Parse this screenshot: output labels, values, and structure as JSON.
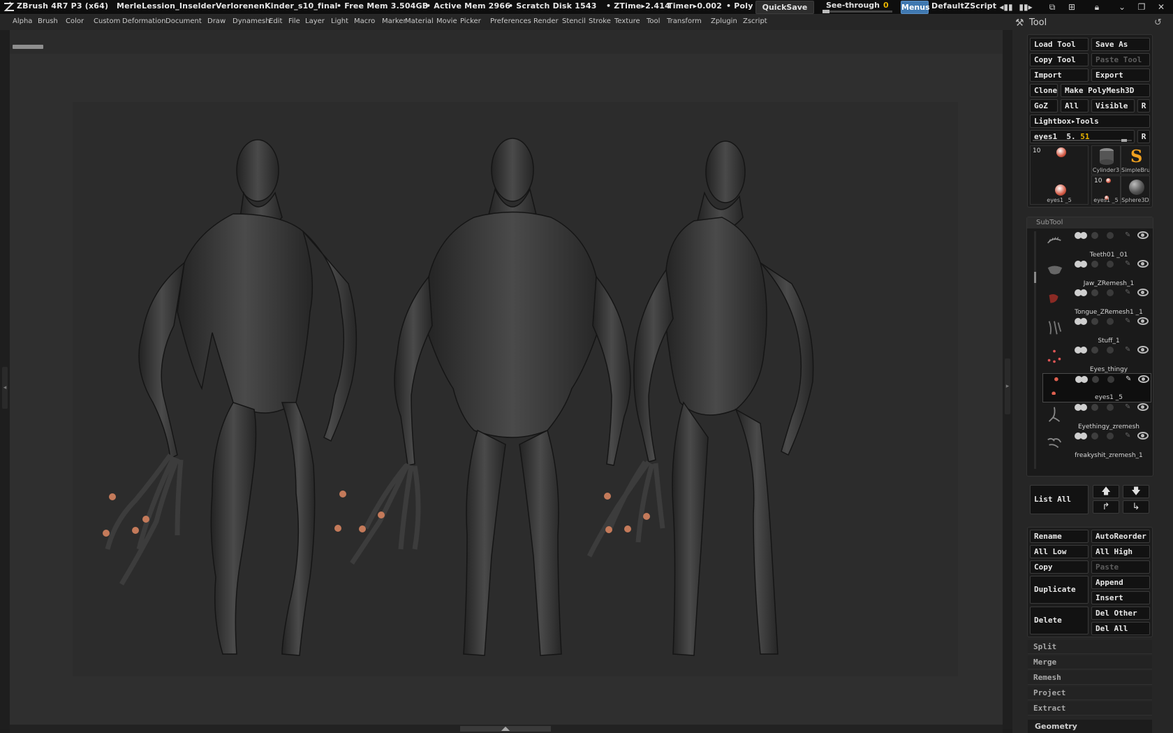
{
  "titlebar": {
    "app": "ZBrush 4R7 P3 (x64)",
    "document": "MerleLession_InselderVerlorenenKinder_s10_final",
    "free_mem": "• Free Mem 3.504GB",
    "active_mem": "• Active Mem 2966",
    "scratch_disk": "• Scratch Disk 1543",
    "ztime": "• ZTime▸2.414",
    "timer": "Timer▸0.002",
    "poly": "• Poly(",
    "quicksave": "QuickSave",
    "see_through_label": "See-through",
    "see_through_value": "0",
    "menus": "Menus",
    "default_zscript": "DefaultZScript"
  },
  "menubar": {
    "items": [
      "Alpha",
      "Brush",
      "Color",
      "Custom",
      "Deformation",
      "Document",
      "Draw",
      "Dynamesh",
      "Edit",
      "File",
      "Layer",
      "Light",
      "Macro",
      "Marker",
      "Material",
      "Movie",
      "Picker",
      "Preferences",
      "Render",
      "Stencil",
      "Stroke",
      "Texture",
      "Tool",
      "Transform",
      "Zplugin",
      "Zscript"
    ]
  },
  "tool_palette": {
    "title": "Tool",
    "buttons": {
      "load_tool": "Load Tool",
      "save_as": "Save As",
      "copy_tool": "Copy Tool",
      "paste_tool": "Paste Tool",
      "import": "Import",
      "export": "Export",
      "clone": "Clone",
      "make_polymesh3d": "Make PolyMesh3D",
      "goz": "GoZ",
      "all": "All",
      "visible": "Visible",
      "r": "R",
      "lightbox_tools": "Lightbox▸Tools"
    },
    "current_tool": {
      "name": "eyes1 _5.",
      "value": "51",
      "r": "R"
    },
    "thumbnails": [
      {
        "count": "10",
        "caption": "eyes1 _5"
      },
      {
        "count": "",
        "caption": "Cylinder3"
      },
      {
        "count": "",
        "caption": "SimpleBru"
      },
      {
        "count": "10",
        "caption": "eyes1 _5"
      },
      {
        "count": "",
        "caption": "Sphere3D"
      }
    ]
  },
  "subtool": {
    "title": "SubTool",
    "items": [
      {
        "name": "Teeth01 _01",
        "selected": false
      },
      {
        "name": "Jaw_ZRemesh_1",
        "selected": false
      },
      {
        "name": "Tongue_ZRemesh1 _1",
        "selected": false
      },
      {
        "name": "Stuff_1",
        "selected": false
      },
      {
        "name": "Eyes_thingy",
        "selected": false
      },
      {
        "name": "eyes1 _5",
        "selected": true
      },
      {
        "name": "Eyethingy_zremesh",
        "selected": false
      },
      {
        "name": "freakyshit_zremesh_1",
        "selected": false
      }
    ],
    "list_all": "List All",
    "rename": "Rename",
    "autoreorder": "AutoReorder",
    "all_low": "All Low",
    "all_high": "All High",
    "copy": "Copy",
    "paste": "Paste",
    "duplicate": "Duplicate",
    "append": "Append",
    "insert": "Insert",
    "delete": "Delete",
    "del_other": "Del Other",
    "del_all": "Del All"
  },
  "sections": [
    "Split",
    "Merge",
    "Remesh",
    "Project",
    "Extract"
  ],
  "geometry_label": "Geometry",
  "colors": {
    "accent_blue": "#3f78b0",
    "value_yellow": "#e8b400",
    "canvas_bg": "#2f2f2f",
    "panel_bg": "#262626"
  }
}
